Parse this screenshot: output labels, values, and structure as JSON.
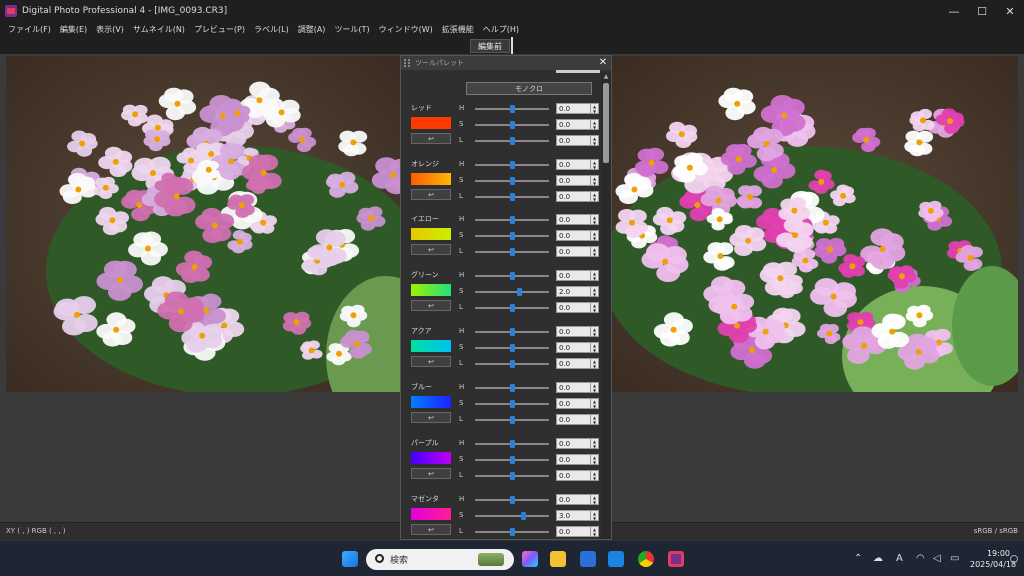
{
  "window": {
    "title": "Digital Photo Professional 4 - [IMG_0093.CR3]",
    "controls": [
      "—",
      "☐",
      "✕"
    ]
  },
  "menu": [
    "ファイル(F)",
    "編集(E)",
    "表示(V)",
    "サムネイル(N)",
    "プレビュー(P)",
    "ラベル(L)",
    "調整(A)",
    "ツール(T)",
    "ウィンドウ(W)",
    "拡張機能",
    "ヘルプ(H)"
  ],
  "toolbar": {
    "before_label": "編集前"
  },
  "palette": {
    "title": "ツールパレット",
    "mono_label": "モノクロ",
    "groups": [
      {
        "name": "レッド",
        "color": "#ff3a00",
        "gradient": "",
        "h": "0.0",
        "s": "0.0",
        "l": "0.0",
        "h_pos": 0.5,
        "s_pos": 0.5,
        "l_pos": 0.5
      },
      {
        "name": "オレンジ",
        "color": "#ff7a00",
        "gradient": "linear-gradient(90deg,#ff5a00,#ffb800)",
        "h": "0.0",
        "s": "0.0",
        "l": "0.0",
        "h_pos": 0.5,
        "s_pos": 0.5,
        "l_pos": 0.5
      },
      {
        "name": "イエロー",
        "color": "#d8e000",
        "gradient": "linear-gradient(90deg,#e8c800,#c8f000)",
        "h": "0.0",
        "s": "0.0",
        "l": "0.0",
        "h_pos": 0.5,
        "s_pos": 0.5,
        "l_pos": 0.5
      },
      {
        "name": "グリーン",
        "color": "#40e040",
        "gradient": "linear-gradient(90deg,#a0f000,#20e080)",
        "h": "0.0",
        "s": "2.0",
        "l": "0.0",
        "h_pos": 0.5,
        "s_pos": 0.6,
        "l_pos": 0.5
      },
      {
        "name": "アクア",
        "color": "#00d0c0",
        "gradient": "linear-gradient(90deg,#00e0a0,#00c0f0)",
        "h": "0.0",
        "s": "0.0",
        "l": "0.0",
        "h_pos": 0.5,
        "s_pos": 0.5,
        "l_pos": 0.5
      },
      {
        "name": "ブルー",
        "color": "#2040ff",
        "gradient": "linear-gradient(90deg,#0080ff,#2020ff)",
        "h": "0.0",
        "s": "0.0",
        "l": "0.0",
        "h_pos": 0.5,
        "s_pos": 0.5,
        "l_pos": 0.5
      },
      {
        "name": "パープル",
        "color": "#8000ff",
        "gradient": "linear-gradient(90deg,#4000ff,#c000f0)",
        "h": "0.0",
        "s": "0.0",
        "l": "0.0",
        "h_pos": 0.5,
        "s_pos": 0.5,
        "l_pos": 0.5
      },
      {
        "name": "マゼンタ",
        "color": "#ff00c0",
        "gradient": "linear-gradient(90deg,#e000e0,#ff2090)",
        "h": "0.0",
        "s": "3.0",
        "l": "0.0",
        "h_pos": 0.5,
        "s_pos": 0.65,
        "l_pos": 0.5
      }
    ]
  },
  "status": {
    "left": "XY (    ,    ) RGB (    ,    ,    )",
    "right": "sRGB / sRGB"
  },
  "taskbar": {
    "search_placeholder": "検索",
    "time": "19:00",
    "date": "2025/04/18",
    "ime": "A"
  }
}
